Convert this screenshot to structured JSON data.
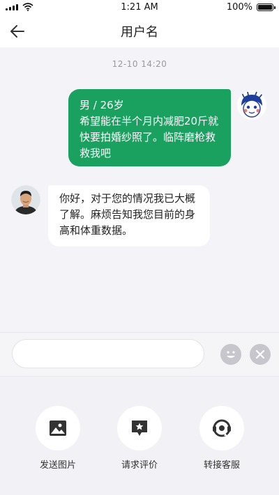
{
  "status_bar": {
    "time": "1:21 AM",
    "battery": "100%"
  },
  "nav": {
    "title": "用户名",
    "back_icon": "arrow-left-icon"
  },
  "chat": {
    "timestamp": "12-10  14:20",
    "messages": [
      {
        "sender": "user",
        "lines": [
          "男 / 26岁",
          "希望能在半个月内减肥20斤就",
          "快要拍婚纱照了。临阵磨枪救",
          "救我吧"
        ]
      },
      {
        "sender": "agent",
        "lines": [
          "你好，对于您的情况我已大概",
          "了解。麻烦告知我您目前的身",
          "高和体重数据。"
        ]
      }
    ]
  },
  "input": {
    "value": "",
    "placeholder": ""
  },
  "actions": [
    {
      "label": "发送图片",
      "icon": "image-icon"
    },
    {
      "label": "请求评价",
      "icon": "rating-icon"
    },
    {
      "label": "转接客服",
      "icon": "customer-service-icon"
    }
  ],
  "colors": {
    "accent": "#1aa05f",
    "chat_bg": "#f3f3f8"
  }
}
